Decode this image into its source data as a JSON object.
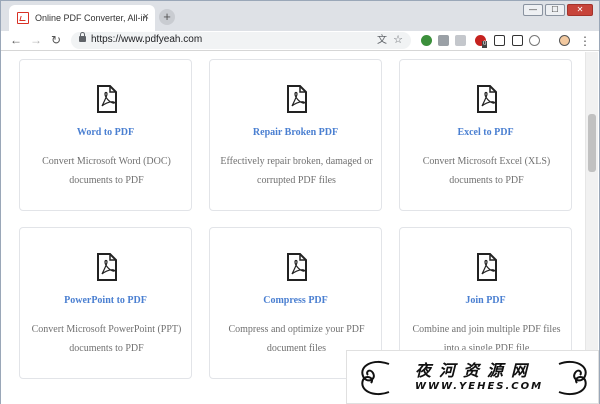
{
  "browser": {
    "tab_title": "Online PDF Converter, All-in-O",
    "tab_close": "×",
    "new_tab": "+",
    "url": "https://www.pdfyeah.com",
    "controls": {
      "minimize": "—",
      "maximize": "☐",
      "close": "✕"
    },
    "nav": {
      "back": "←",
      "forward": "→",
      "reload": "↻"
    },
    "omnibox_icons": {
      "translate": "文",
      "star": "☆"
    },
    "extension_badge": "0",
    "menu": "⋮"
  },
  "cards": [
    {
      "title": "Word to PDF",
      "desc": "Convert Microsoft Word (DOC) documents to PDF"
    },
    {
      "title": "Repair Broken PDF",
      "desc": "Effectively repair broken, damaged or corrupted PDF files"
    },
    {
      "title": "Excel to PDF",
      "desc": "Convert Microsoft Excel (XLS) documents to PDF"
    },
    {
      "title": "PowerPoint to PDF",
      "desc": "Convert Microsoft PowerPoint (PPT) documents to PDF"
    },
    {
      "title": "Compress PDF",
      "desc": "Compress and optimize your PDF document files"
    },
    {
      "title": "Join PDF",
      "desc": "Combine and join multiple PDF files into a single PDF file"
    }
  ],
  "watermark": {
    "title": "夜河资源网",
    "url": "WWW.YEHES.COM"
  },
  "icons": {
    "card": "pdf-file-icon",
    "favicon": "pdf-favicon-icon",
    "lock": "lock-icon"
  },
  "colors": {
    "link_blue": "#4a7fd1",
    "text_gray": "#707070",
    "chrome": "#dee1e6"
  }
}
